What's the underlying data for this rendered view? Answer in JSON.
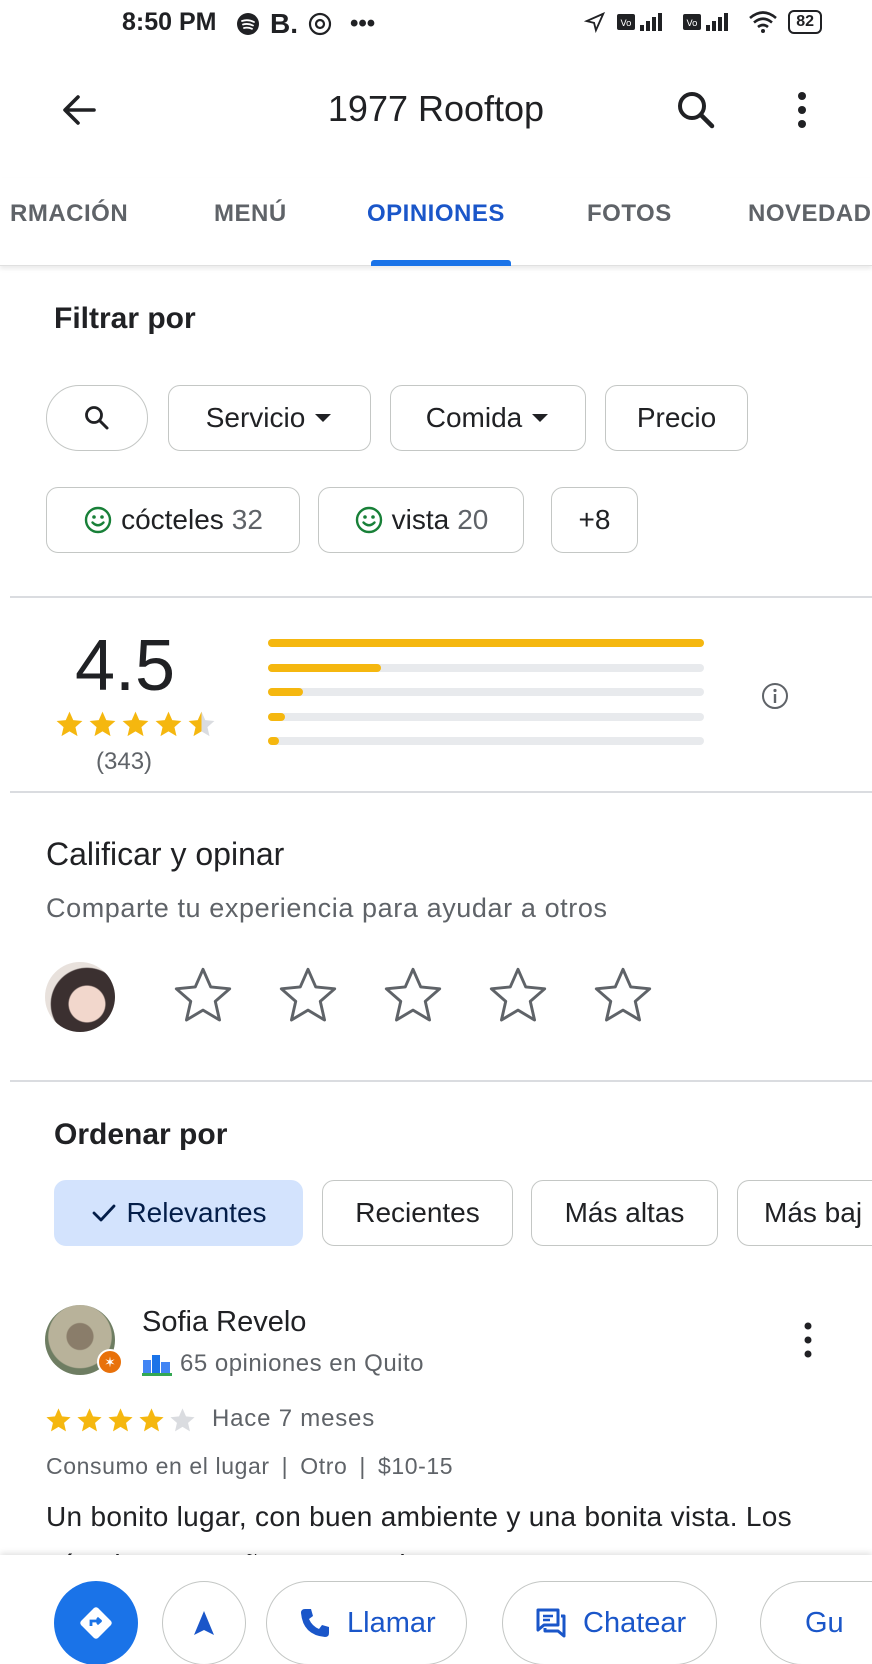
{
  "status_bar": {
    "time": "8:50 PM",
    "icons_left": [
      "spotify-icon",
      "b-icon",
      "threads-icon",
      "more-dots"
    ],
    "battery": "82"
  },
  "app_bar": {
    "title": "1977 Rooftop"
  },
  "tabs": [
    {
      "label": "RMACIÓN",
      "active": false
    },
    {
      "label": "MENÚ",
      "active": false
    },
    {
      "label": "OPINIONES",
      "active": true
    },
    {
      "label": "FOTOS",
      "active": false
    },
    {
      "label": "NOVEDAD",
      "active": false
    }
  ],
  "filter": {
    "heading": "Filtrar por",
    "chips": [
      {
        "label": "Servicio"
      },
      {
        "label": "Comida"
      },
      {
        "label": "Precio"
      }
    ],
    "topics": [
      {
        "label": "cócteles",
        "count": "32"
      },
      {
        "label": "vista",
        "count": "20"
      },
      {
        "label": "+8"
      }
    ]
  },
  "summary": {
    "rating": "4.5",
    "stars": 4.5,
    "count": "(343)",
    "distribution_fractions": [
      1.0,
      0.26,
      0.08,
      0.04,
      0.025
    ],
    "accent_color": "#f5b70f"
  },
  "rate": {
    "title": "Calificar y opinar",
    "subtitle": "Comparte tu experiencia para ayudar a otros"
  },
  "sort": {
    "heading": "Ordenar por",
    "options": [
      {
        "label": "Relevantes",
        "selected": true
      },
      {
        "label": "Recientes",
        "selected": false
      },
      {
        "label": "Más altas",
        "selected": false
      },
      {
        "label": "Más baj",
        "selected": false
      }
    ]
  },
  "review": {
    "author": "Sofia Revelo",
    "author_meta": "65 opiniones en Quito",
    "stars": 4,
    "date": "Hace 7 meses",
    "tags": [
      "Consumo en el lugar",
      "Otro",
      "$10-15"
    ],
    "text": "Un bonito lugar, con buen ambiente y una bonita vista. Los cócteles con caña son muy buenos y"
  },
  "bottom_bar": {
    "call": "Llamar",
    "chat": "Chatear",
    "save": "Gu"
  }
}
